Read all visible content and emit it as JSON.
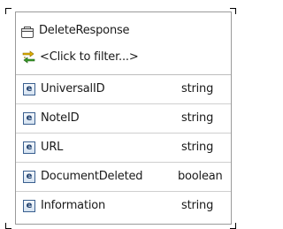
{
  "header": {
    "title": "DeleteResponse",
    "title_icon": "document-box-icon",
    "filter_label": "<Click to filter...>",
    "filter_icon": "filter-arrows-icon"
  },
  "rows": [
    {
      "icon_letter": "e",
      "name": "UniversalID",
      "type": "string"
    },
    {
      "icon_letter": "e",
      "name": "NoteID",
      "type": "string"
    },
    {
      "icon_letter": "e",
      "name": "URL",
      "type": "string"
    },
    {
      "icon_letter": "e",
      "name": "DocumentDeleted",
      "type": "boolean"
    },
    {
      "icon_letter": "e",
      "name": "Information",
      "type": "string"
    }
  ],
  "colors": {
    "border": "#9a9a9a",
    "element_icon_border": "#3a5f8f",
    "element_icon_text": "#1d3d6b",
    "filter_icon_yellow": "#e0b000",
    "filter_icon_green": "#3a9a2a"
  }
}
